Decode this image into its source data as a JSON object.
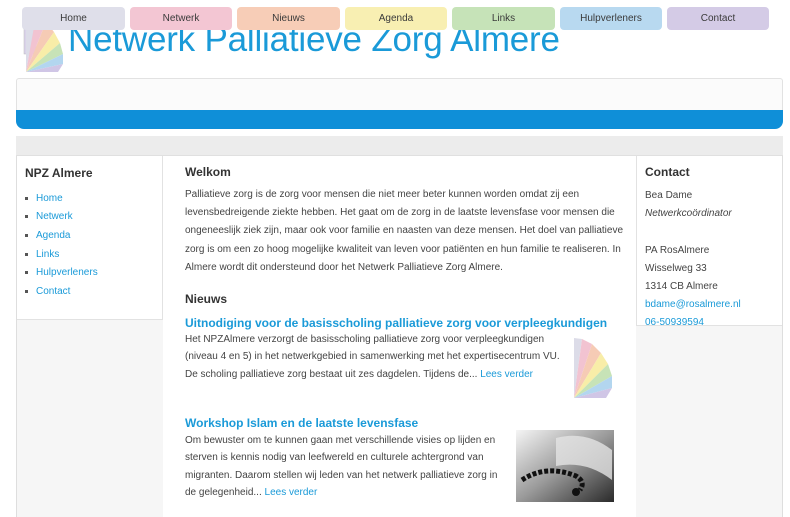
{
  "site": {
    "title": "Netwerk Palliatieve Zorg Almere"
  },
  "nav": {
    "items": [
      {
        "label": "Home",
        "color": "#dfdfea"
      },
      {
        "label": "Netwerk",
        "color": "#f3c6d3"
      },
      {
        "label": "Nieuws",
        "color": "#f7cdb7"
      },
      {
        "label": "Agenda",
        "color": "#f8efb2"
      },
      {
        "label": "Links",
        "color": "#c6e3b8"
      },
      {
        "label": "Hulpverleners",
        "color": "#b8d9f0"
      },
      {
        "label": "Contact",
        "color": "#d4cbe6"
      }
    ],
    "bar_color": "#0f8fd8"
  },
  "sidebar": {
    "title": "NPZ Almere",
    "items": [
      {
        "label": "Home"
      },
      {
        "label": "Netwerk"
      },
      {
        "label": "Agenda"
      },
      {
        "label": "Links"
      },
      {
        "label": "Hulpverleners"
      },
      {
        "label": "Contact"
      }
    ]
  },
  "main": {
    "title": "Welkom",
    "intro": "Palliatieve zorg is de zorg voor mensen die niet meer beter kunnen worden omdat zij een levensbedreigende ziekte hebben. Het gaat om de zorg in de laatste levensfase voor mensen die ongeneeslijk ziek zijn, maar ook voor familie en naasten van deze mensen. Het doel van palliatieve zorg is om een zo hoog mogelijke kwaliteit van leven voor patiënten en hun familie te realiseren. In Almere wordt dit ondersteund door het Netwerk Palliatieve Zorg Almere.",
    "news_heading": "Nieuws",
    "news": [
      {
        "title": "Uitnodiging voor de basisscholing palliatieve zorg voor verpleegkundigen",
        "text": "Het NPZAlmere verzorgt de basisscholing palliatieve zorg voor verpleegkundigen (niveau 4 en 5) in het netwerkgebied in samenwerking met het expertisecentrum VU. De scholing palliatieve zorg bestaat uit zes dagdelen. Tijdens de...",
        "more": "Lees verder"
      },
      {
        "title": "Workshop Islam en de laatste levensfase",
        "text": "Om bewuster om te kunnen gaan met verschillende visies op lijden en sterven is kennis nodig van leefwereld en culturele achtergrond van migranten. Daarom stellen wij leden van het netwerk palliatieve zorg in de gelegenheid...",
        "more": "Lees verder"
      }
    ]
  },
  "contact": {
    "title": "Contact",
    "name": "Bea Dame",
    "role": "Netwerkcoördinator",
    "org": "PA RosAlmere",
    "street": "Wisselweg 33",
    "city": "1314 CB Almere",
    "email": "bdame@rosalmere.nl",
    "phone": "06-50939594"
  },
  "colors": {
    "accent": "#1a9ad8",
    "bar": "#0f8fd8"
  }
}
